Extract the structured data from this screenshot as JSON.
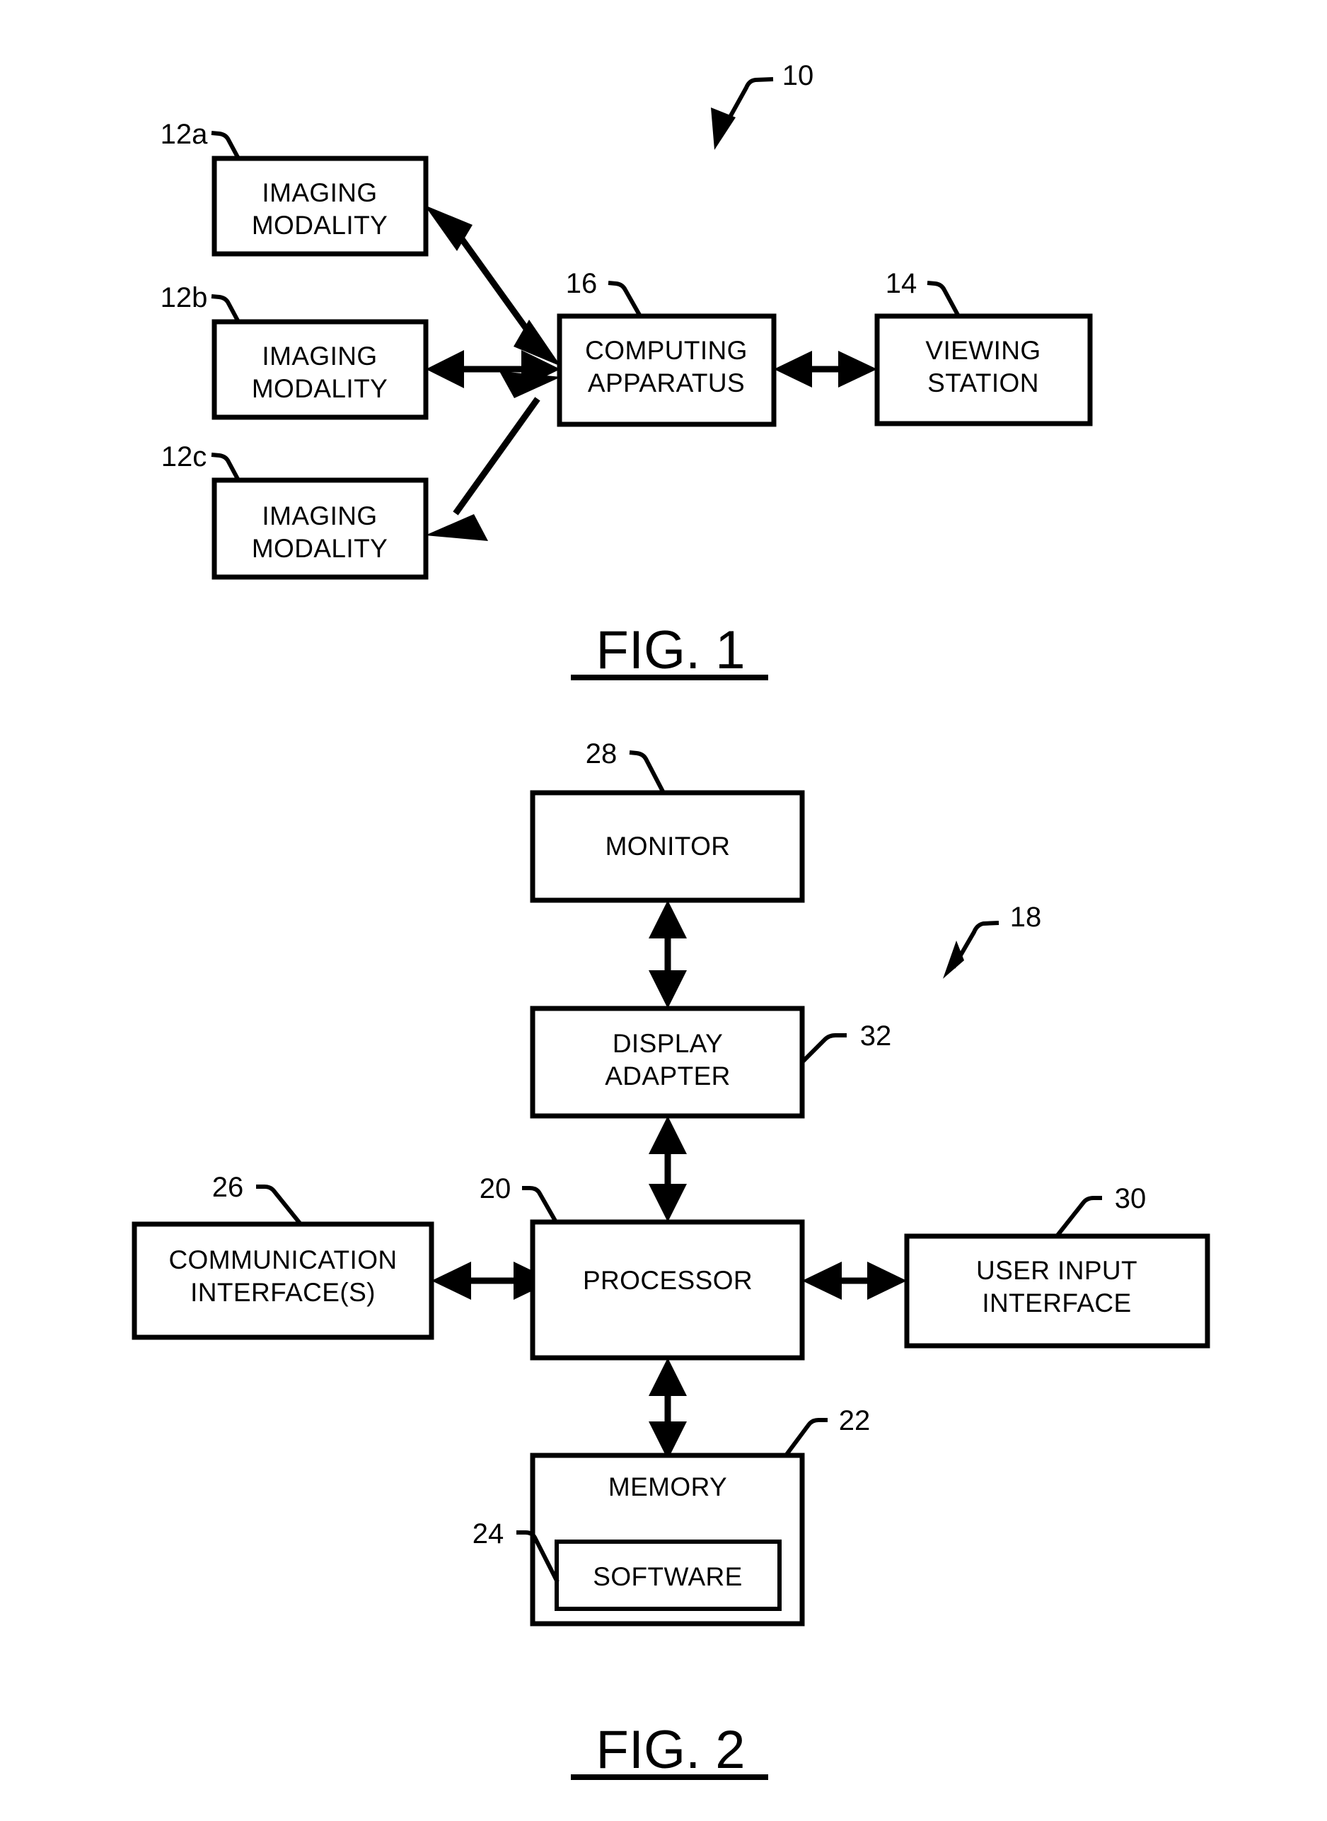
{
  "document": {
    "type": "patent-figure-sheet",
    "figures": [
      {
        "caption": "FIG. 1",
        "system_ref": "10",
        "blocks": [
          {
            "ref": "12a",
            "line1": "IMAGING",
            "line2": "MODALITY"
          },
          {
            "ref": "12b",
            "line1": "IMAGING",
            "line2": "MODALITY"
          },
          {
            "ref": "12c",
            "line1": "IMAGING",
            "line2": "MODALITY"
          },
          {
            "ref": "16",
            "line1": "COMPUTING",
            "line2": "APPARATUS"
          },
          {
            "ref": "14",
            "line1": "VIEWING",
            "line2": "STATION"
          }
        ]
      },
      {
        "caption": "FIG. 2",
        "system_ref": "18",
        "blocks": [
          {
            "ref": "28",
            "line1": "MONITOR",
            "line2": ""
          },
          {
            "ref": "32",
            "line1": "DISPLAY",
            "line2": "ADAPTER"
          },
          {
            "ref": "26",
            "line1": "COMMUNICATION",
            "line2": "INTERFACE(S)"
          },
          {
            "ref": "20",
            "line1": "PROCESSOR",
            "line2": ""
          },
          {
            "ref": "30",
            "line1": "USER INPUT",
            "line2": "INTERFACE"
          },
          {
            "ref": "22",
            "line1": "MEMORY",
            "line2": ""
          },
          {
            "ref": "24",
            "line1": "SOFTWARE",
            "line2": ""
          }
        ]
      }
    ]
  },
  "fig1": {
    "caption": "FIG. 1",
    "system_ref": "10",
    "modality_a": {
      "ref": "12a",
      "line1": "IMAGING",
      "line2": "MODALITY"
    },
    "modality_b": {
      "ref": "12b",
      "line1": "IMAGING",
      "line2": "MODALITY"
    },
    "modality_c": {
      "ref": "12c",
      "line1": "IMAGING",
      "line2": "MODALITY"
    },
    "computing": {
      "ref": "16",
      "line1": "COMPUTING",
      "line2": "APPARATUS"
    },
    "viewing": {
      "ref": "14",
      "line1": "VIEWING",
      "line2": "STATION"
    }
  },
  "fig2": {
    "caption": "FIG. 2",
    "system_ref": "18",
    "monitor": {
      "ref": "28",
      "label": "MONITOR"
    },
    "display_adapter": {
      "ref": "32",
      "line1": "DISPLAY",
      "line2": "ADAPTER"
    },
    "communication": {
      "ref": "26",
      "line1": "COMMUNICATION",
      "line2": "INTERFACE(S)"
    },
    "processor": {
      "ref": "20",
      "label": "PROCESSOR"
    },
    "user_input": {
      "ref": "30",
      "line1": "USER INPUT",
      "line2": "INTERFACE"
    },
    "memory": {
      "ref": "22",
      "label": "MEMORY"
    },
    "software": {
      "ref": "24",
      "label": "SOFTWARE"
    }
  },
  "colors": {
    "ink": "#000000",
    "paper": "#ffffff"
  }
}
